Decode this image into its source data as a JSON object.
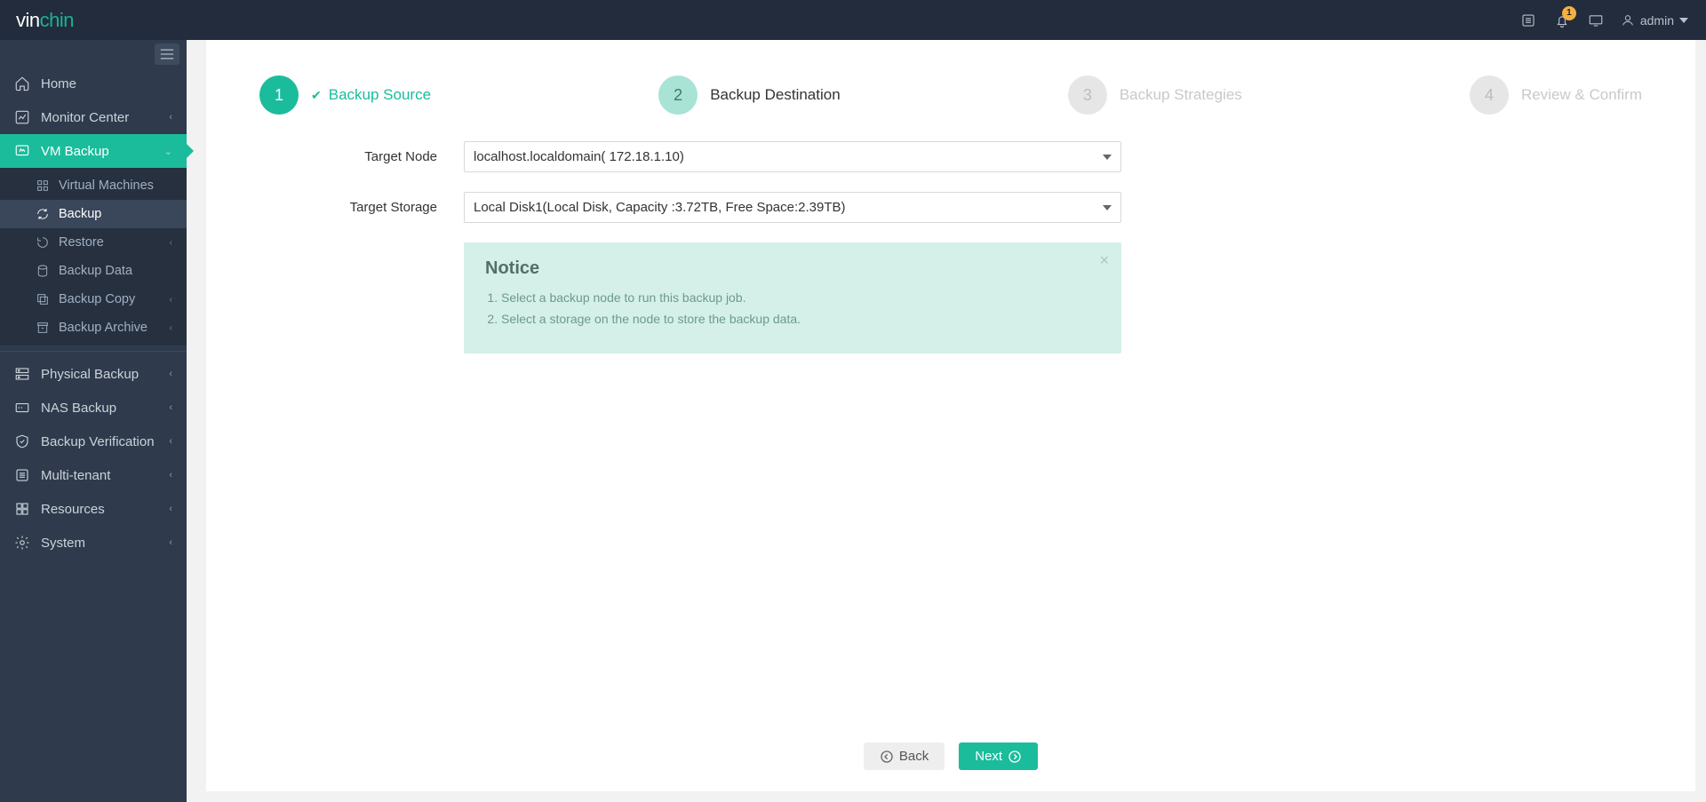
{
  "brand": {
    "vin": "vin",
    "chin": "chin"
  },
  "topbar": {
    "notifications_count": "1",
    "user_label": "admin"
  },
  "sidebar": {
    "home": "Home",
    "monitor_center": "Monitor Center",
    "vm_backup": "VM Backup",
    "sub": {
      "virtual_machines": "Virtual Machines",
      "backup": "Backup",
      "restore": "Restore",
      "backup_data": "Backup Data",
      "backup_copy": "Backup Copy",
      "backup_archive": "Backup Archive"
    },
    "physical_backup": "Physical Backup",
    "nas_backup": "NAS Backup",
    "backup_verification": "Backup Verification",
    "multi_tenant": "Multi-tenant",
    "resources": "Resources",
    "system": "System"
  },
  "wizard": {
    "step1": {
      "num": "1",
      "label": "Backup Source"
    },
    "step2": {
      "num": "2",
      "label": "Backup Destination"
    },
    "step3": {
      "num": "3",
      "label": "Backup Strategies"
    },
    "step4": {
      "num": "4",
      "label": "Review & Confirm"
    }
  },
  "form": {
    "target_node_label": "Target Node",
    "target_node_value": "localhost.localdomain( 172.18.1.10)",
    "target_storage_label": "Target Storage",
    "target_storage_value": "Local Disk1(Local Disk, Capacity :3.72TB, Free Space:2.39TB)"
  },
  "notice": {
    "title": "Notice",
    "items": [
      "Select a backup node to run this backup job.",
      "Select a storage on the node to store the backup data."
    ]
  },
  "footer": {
    "back": "Back",
    "next": "Next"
  }
}
